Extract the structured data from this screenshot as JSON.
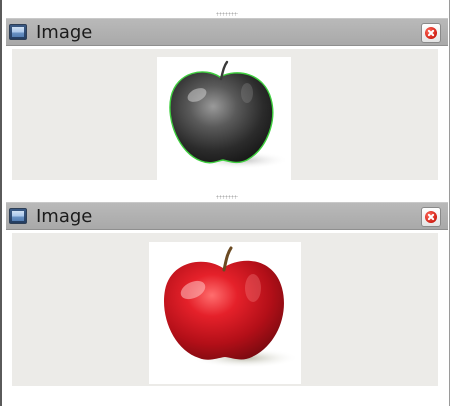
{
  "panels": [
    {
      "title": "Image",
      "icon": "image-window-icon",
      "close_icon": "close-icon",
      "picture": "grayscale-apple-with-green-contour"
    },
    {
      "title": "Image",
      "icon": "image-window-icon",
      "close_icon": "close-icon",
      "picture": "red-apple"
    }
  ]
}
